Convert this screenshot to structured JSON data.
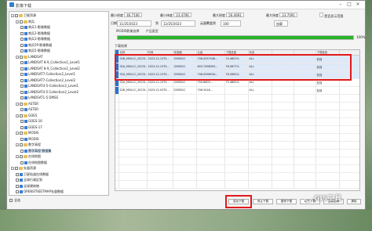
{
  "window": {
    "title": "影像下载"
  },
  "filters": {
    "min_lon_label": "最小经度",
    "min_lon_value": "46.7106",
    "min_lat_label": "最小纬度",
    "min_lat_value": "23.4706",
    "max_lon_label": "最大经度",
    "max_lon_value": "56.4691",
    "max_lat_label": "最大纬度",
    "max_lat_value": "23.7091",
    "show_aoi_label": "是否显示范围",
    "date_label": "日期",
    "date_start": "11/25/2023",
    "to_label": "到",
    "date_end": "12/25/2023",
    "cloud_label": "云量覆盖到",
    "cloud_value": "100",
    "extra_label": "加载"
  },
  "tabs": [
    "MODIS影像选择",
    "产品类型"
  ],
  "progress": {
    "percent": 100,
    "label": "100%"
  },
  "results_label": "下载结果",
  "tree": {
    "items": [
      {
        "label": "卫星资源",
        "level": 0,
        "type": "folder"
      },
      {
        "label": "哨兵",
        "level": 1,
        "type": "folder"
      },
      {
        "label": "哨兵1-影像数据",
        "level": 2,
        "type": "leaf"
      },
      {
        "label": "哨兵2-影像数据",
        "level": 2,
        "type": "leaf"
      },
      {
        "label": "哨兵3-影像数据",
        "level": 2,
        "type": "leaf"
      },
      {
        "label": "哨兵5P-影像数据",
        "level": 2,
        "type": "leaf"
      },
      {
        "label": "哨兵5-影像数据",
        "level": 2,
        "type": "leaf"
      },
      {
        "label": "LANDSAT",
        "level": 1,
        "type": "folder"
      },
      {
        "label": "LANDSAT 8-9_Collection2_Level1",
        "level": 2,
        "type": "leaf"
      },
      {
        "label": "LANDSAT 8-9_Collection2_Level2",
        "level": 2,
        "type": "leaf"
      },
      {
        "label": "LANDSAT7-Collection2_Level1",
        "level": 2,
        "type": "leaf"
      },
      {
        "label": "LANDSAT7-Collection2_Level2",
        "level": 2,
        "type": "leaf"
      },
      {
        "label": "LANDSAT4-5-Collection2_Level1",
        "level": 2,
        "type": "leaf"
      },
      {
        "label": "LANDSAT4-5-Collection2_Level2",
        "level": 2,
        "type": "leaf"
      },
      {
        "label": "LANDSAT1-5 DMSS",
        "level": 2,
        "type": "leaf"
      },
      {
        "label": "ASTER",
        "level": 1,
        "type": "folder"
      },
      {
        "label": "ASTER",
        "level": 2,
        "type": "leaf"
      },
      {
        "label": "GOES",
        "level": 1,
        "type": "folder"
      },
      {
        "label": "GOES-16",
        "level": 2,
        "type": "leaf"
      },
      {
        "label": "GOES-17",
        "level": 2,
        "type": "leaf"
      },
      {
        "label": "MODIS",
        "level": 1,
        "type": "folder"
      },
      {
        "label": "MODIS",
        "level": 2,
        "type": "leaf"
      },
      {
        "label": "数字高程",
        "level": 1,
        "type": "folder"
      },
      {
        "label": "数字高程-数据集",
        "level": 2,
        "type": "leaf",
        "selected": true
      },
      {
        "label": "在线地图",
        "level": 1,
        "type": "folder"
      },
      {
        "label": "在线地图数据",
        "level": 2,
        "type": "leaf"
      },
      {
        "label": "矢量资源",
        "level": 0,
        "type": "folder"
      },
      {
        "label": "卫星轨道在线数据",
        "level": 1,
        "type": "leaf"
      },
      {
        "label": "全球行政区划",
        "level": 1,
        "type": "leaf"
      },
      {
        "label": "全球建筑物",
        "level": 1,
        "type": "leaf"
      },
      {
        "label": "OPENSTREETMAP矢量数据",
        "level": 1,
        "type": "leaf"
      }
    ],
    "all_label": "全选"
  },
  "table": {
    "headers": [
      "",
      "名称",
      "时间",
      "传感器",
      "云量",
      "下载进度",
      "状态",
      "下载链接"
    ],
    "rows": [
      {
        "name": "S2B_MSIL1C_20231...",
        "date": "2023-12-13T0...",
        "sensor": "S2MSI1C",
        "size": "748.4257446...",
        "progress": "74.4801%",
        "status": "ALL",
        "action": "在线"
      },
      {
        "name": "S2A_MSIL1C_20231...",
        "date": "2023-12-13T0...",
        "sensor": "S2MSI1C",
        "size": "603.7498093...",
        "progress": "76.0877%",
        "status": "ALL",
        "action": "在线"
      },
      {
        "name": "S2A_MSIL1C_20231...",
        "date": "2023-12-13T0...",
        "sensor": "S2MSI1C",
        "size": "748.0098934...",
        "progress": "76.4981%",
        "status": "ALL",
        "action": "在线"
      },
      {
        "name": "S2A_MSIL1C_20231...",
        "date": "2023-12-10T0...",
        "sensor": "S2MSI1C",
        "size": "750.6803...",
        "progress": "75.4881%",
        "status": "ALL",
        "action": "在线"
      },
      {
        "name": "S2B_MSIL1C_20231...",
        "date": "2023-12-03T0...",
        "sensor": "S2MSI1C",
        "size": "706.3418...",
        "progress": "",
        "status": "ALL",
        "action": "在线"
      }
    ]
  },
  "buttons": {
    "download": "成功下载",
    "stop": "停止下载",
    "pause": "暂停下载",
    "continue": "继续下载",
    "select_all": "全部选择",
    "clear": "清除"
  },
  "watermark": {
    "text": "GIS工具"
  },
  "colors": {
    "accent_red": "#e0191b",
    "progress_green": "#28b52a",
    "selection_blue": "#2c6fcf"
  }
}
